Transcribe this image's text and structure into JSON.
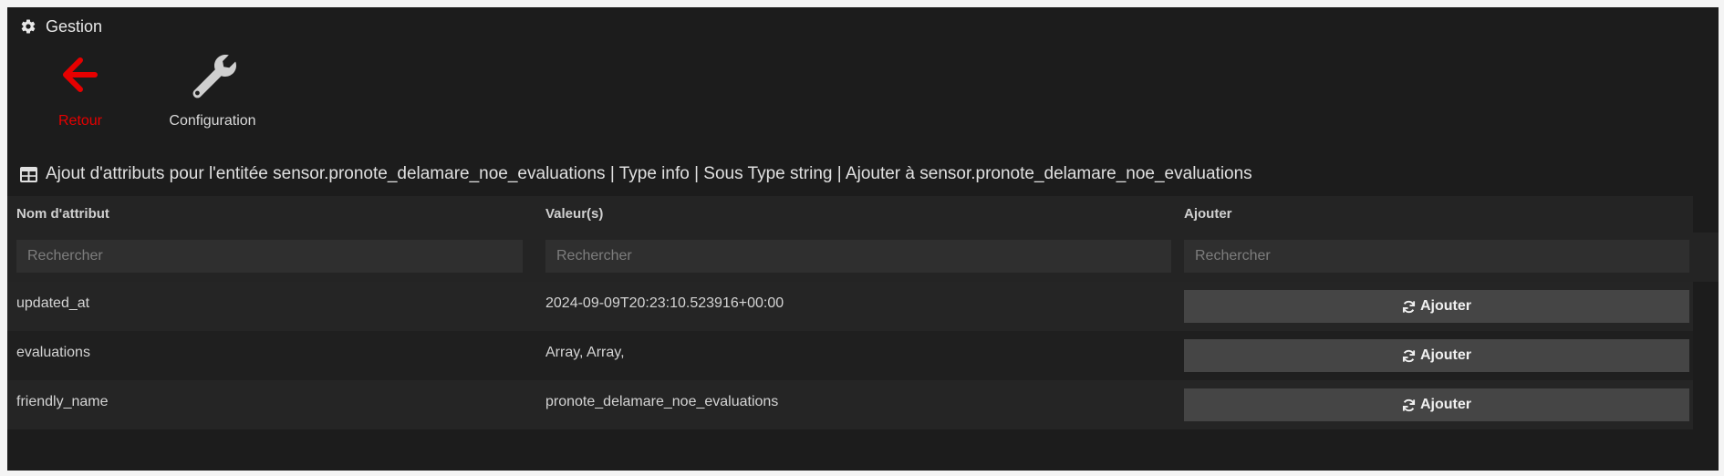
{
  "header": {
    "title": "Gestion",
    "icon": "gear-icon"
  },
  "tiles": {
    "back": {
      "label": "Retour",
      "icon": "arrow-left-icon",
      "color": "#e60000"
    },
    "config": {
      "label": "Configuration",
      "icon": "wrench-icon"
    }
  },
  "section": {
    "icon": "table-icon",
    "title": "Ajout d'attributs pour l'entitée sensor.pronote_delamare_noe_evaluations | Type info | Sous Type string | Ajouter à sensor.pronote_delamare_noe_evaluations"
  },
  "table": {
    "columns": [
      "Nom d'attribut",
      "Valeur(s)",
      "Ajouter"
    ],
    "filter_placeholder": "Rechercher",
    "rows": [
      {
        "name": "updated_at",
        "value": "2024-09-09T20:23:10.523916+00:00",
        "action": "Ajouter"
      },
      {
        "name": "evaluations",
        "value": "Array, Array,",
        "action": "Ajouter"
      },
      {
        "name": "friendly_name",
        "value": "pronote_delamare_noe_evaluations",
        "action": "Ajouter"
      }
    ]
  },
  "colors": {
    "background": "#1c1c1c",
    "accent_red": "#e60000",
    "button": "#454545"
  }
}
